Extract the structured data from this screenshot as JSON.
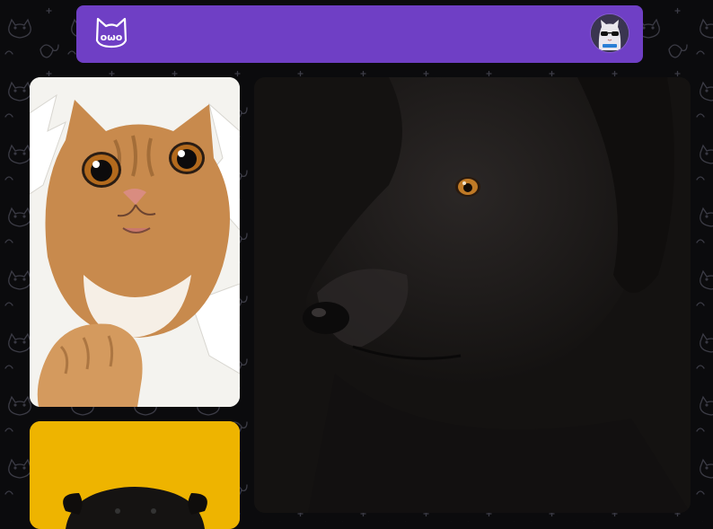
{
  "colors": {
    "header_bg": "#6f3fc5",
    "page_bg": "#0b0b0d",
    "doodle_stroke": "#3a3a44"
  },
  "header": {
    "logo_icon": "owo-cat-face-icon",
    "avatar_icon": "cat-with-sunglasses-avatar"
  },
  "gallery": [
    {
      "image": "orange-tabby-kitten-tearing-through-paper"
    },
    {
      "image": "black-labrador-dog-portrait-dark-background"
    },
    {
      "image": "black-pug-on-yellow-background"
    }
  ]
}
